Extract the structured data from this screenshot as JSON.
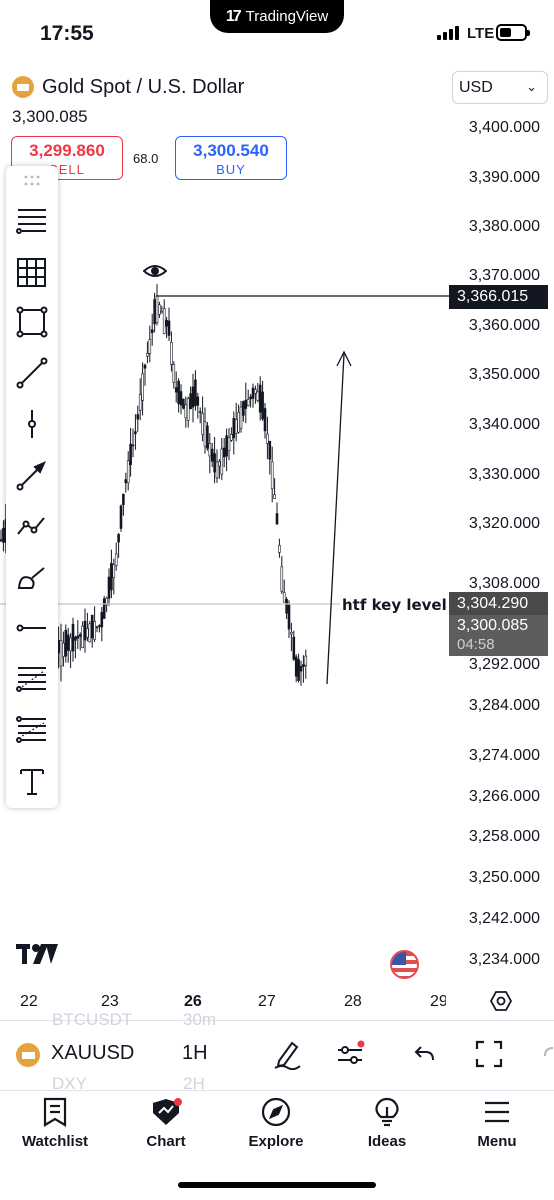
{
  "status_bar": {
    "time": "17:55",
    "app_pill": "TradingView",
    "network": "LTE"
  },
  "header": {
    "symbol_name": "Gold Spot / U.S. Dollar",
    "last_price": "3,300.085",
    "currency": "USD",
    "sell": {
      "price": "3,299.860",
      "label": "SELL"
    },
    "buy": {
      "price": "3,300.540",
      "label": "BUY"
    },
    "spread": "68.0"
  },
  "price_axis": {
    "labels": [
      "3,400.000",
      "3,390.000",
      "3,380.000",
      "3,370.000",
      "3,360.000",
      "3,350.000",
      "3,340.000",
      "3,330.000",
      "3,320.000",
      "3,308.000",
      "3,292.000",
      "3,284.000",
      "3,274.000",
      "3,266.000",
      "3,258.000",
      "3,250.000",
      "3,242.000",
      "3,234.000"
    ],
    "high_tag": "3,366.015",
    "key_level_tag": "3,304.290",
    "current_tag": "3,300.085",
    "countdown": "04:58"
  },
  "annotations": {
    "key_level_text": "htf key level"
  },
  "date_axis": {
    "labels": [
      "22",
      "23",
      "26",
      "27",
      "28",
      "29"
    ],
    "highlighted": "26"
  },
  "symbol_bar": {
    "ticker": "XAUUSD",
    "interval": "1H",
    "ghost_above": [
      "BTCUSDT",
      "30m"
    ],
    "ghost_below": [
      "DXY",
      "2H"
    ]
  },
  "tabs": [
    "Watchlist",
    "Chart",
    "Explore",
    "Ideas",
    "Menu"
  ],
  "colors": {
    "sell": "#f23645",
    "buy": "#2962ff",
    "support_line": "#e03a3a",
    "candle": "#131722"
  },
  "toolbar_icons": [
    "grip-icon",
    "horizontal-lines-icon",
    "grid-icon",
    "rectangle-icon",
    "trend-line-icon",
    "vertical-line-icon",
    "arrow-line-icon",
    "path-icon",
    "brush-icon",
    "horizontal-ray-icon",
    "fib-retracement-icon",
    "fib-extension-icon",
    "text-icon"
  ]
}
